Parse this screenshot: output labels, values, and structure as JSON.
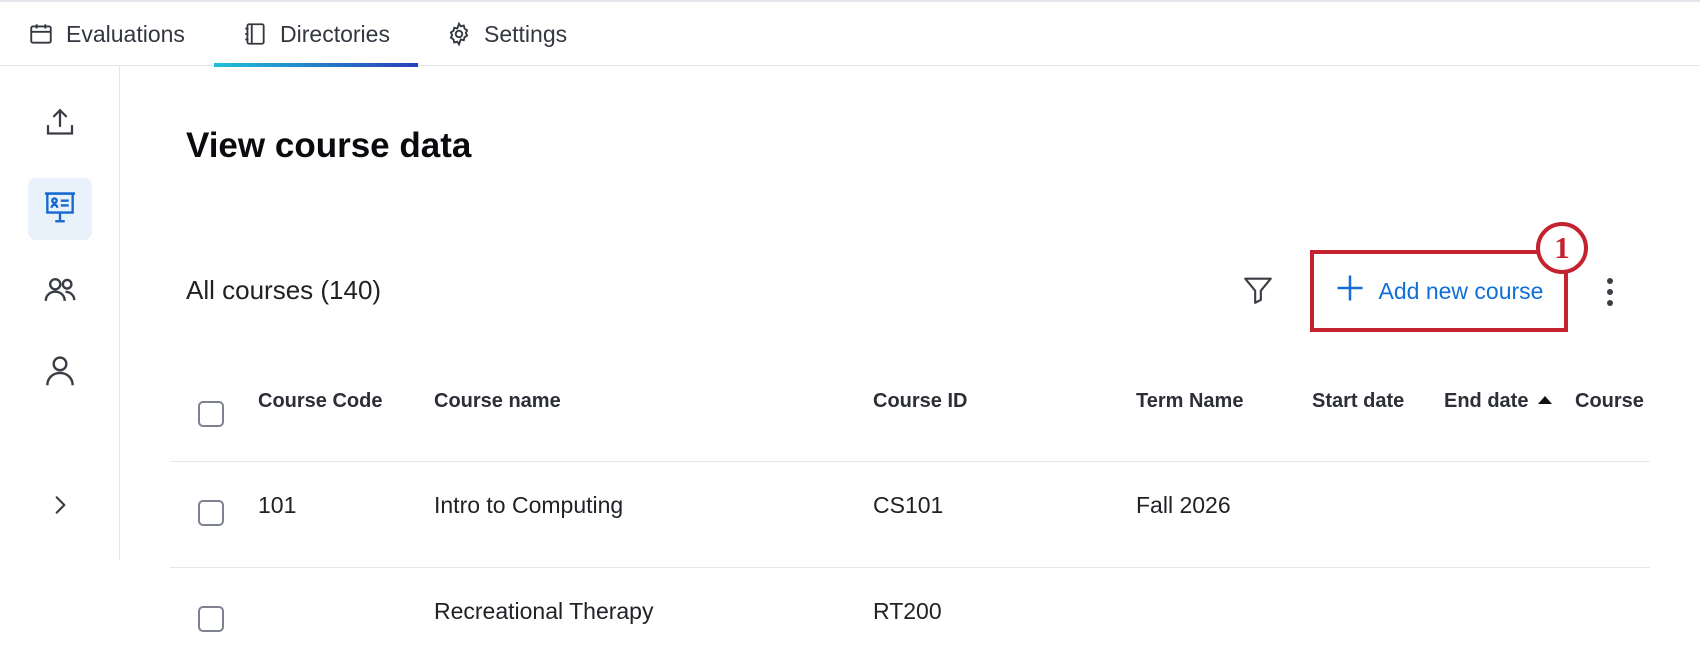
{
  "nav": {
    "tabs": [
      {
        "label": "Evaluations",
        "icon": "calendar-icon"
      },
      {
        "label": "Directories",
        "icon": "notebook-icon",
        "active": true
      },
      {
        "label": "Settings",
        "icon": "gear-icon"
      }
    ],
    "accent_gradient": [
      "#1fc0d8",
      "#2a3fb9"
    ]
  },
  "sidebar": {
    "items": [
      {
        "icon": "upload-icon"
      },
      {
        "icon": "course-board-icon",
        "active": true
      },
      {
        "icon": "users-icon"
      },
      {
        "icon": "user-icon"
      },
      {
        "icon": "chevron-right-icon"
      }
    ]
  },
  "page": {
    "title": "View course data",
    "course_count_label": "All courses (140)"
  },
  "toolbar": {
    "add_label": "Add new course",
    "callout_number": "1",
    "callout_color": "#c4222e",
    "link_color": "#0f6fd6"
  },
  "table": {
    "columns": [
      "Course Code",
      "Course name",
      "Course ID",
      "Term Name",
      "Start date",
      "End date",
      "Course"
    ],
    "sorted_column": "End date",
    "sort_direction": "ascending",
    "rows": [
      {
        "code": "101",
        "name": "Intro to Computing",
        "id": "CS101",
        "term": "Fall 2026",
        "start": "",
        "end": ""
      },
      {
        "code": "",
        "name": "Recreational Therapy",
        "id": "RT200",
        "term": "",
        "start": "",
        "end": ""
      }
    ]
  }
}
